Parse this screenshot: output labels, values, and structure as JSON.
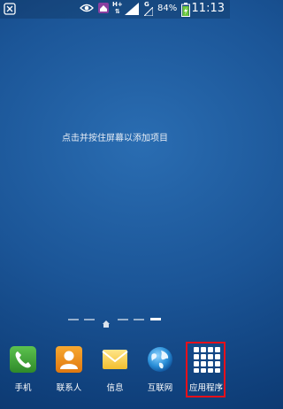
{
  "status_bar": {
    "network_type": "H+",
    "signal_type": "G",
    "battery_percent": "84%",
    "time": "11:13"
  },
  "home": {
    "hint_text": "点击并按住屏幕以添加项目"
  },
  "pager": {
    "pages": 6,
    "active_index": 5
  },
  "dock": [
    {
      "label": "手机",
      "icon": "phone-icon"
    },
    {
      "label": "联系人",
      "icon": "contacts-icon"
    },
    {
      "label": "信息",
      "icon": "messages-icon"
    },
    {
      "label": "互联网",
      "icon": "internet-globe-icon"
    },
    {
      "label": "应用程序",
      "icon": "apps-grid-icon"
    }
  ],
  "colors": {
    "highlight_border": "#e8101a",
    "phone_green": "#3ea335",
    "contacts_orange": "#f0901c",
    "battery_green": "#6cc83c"
  }
}
